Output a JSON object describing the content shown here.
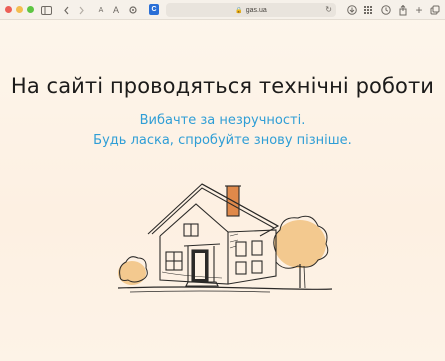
{
  "browser": {
    "url": "gas.ua",
    "text_size_small": "A",
    "text_size_large": "A",
    "extension_label": "C"
  },
  "content": {
    "title": "На сайті проводяться технічні роботи",
    "apology": "Вибачте за незручності.",
    "retry": "Будь ласка, спробуйте знову пізніше."
  },
  "colors": {
    "title": "#1c1b1a",
    "subtitle": "#2f9ed6",
    "house_accent": "#e0894a",
    "tree_fill": "#f3c98f"
  },
  "illustration": {
    "icon": "house-sketch-icon"
  }
}
